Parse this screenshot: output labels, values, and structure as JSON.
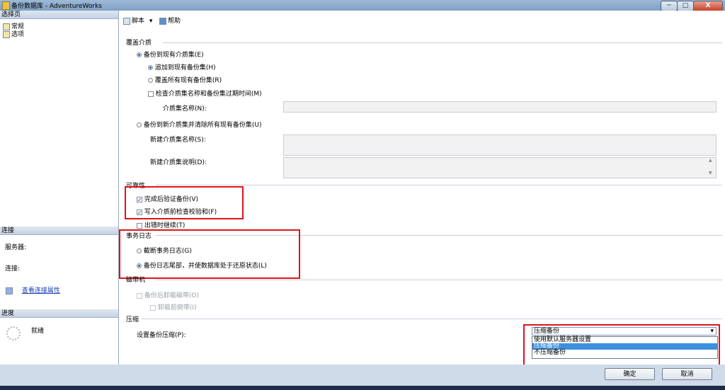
{
  "window": {
    "title": "备份数据库 - AdventureWorks",
    "min_label": "─",
    "max_label": "□",
    "close_label": "X"
  },
  "left": {
    "select_page_header": "选择页",
    "pages": [
      "常规",
      "选项"
    ],
    "connection_header": "连接",
    "server_label": "服务器:",
    "connection_label": "连接:",
    "view_connection_props": "查看连接属性",
    "progress_header": "进度",
    "progress_status": "就绪"
  },
  "toolbar": {
    "script_label": "脚本",
    "help_label": "帮助"
  },
  "overwrite_media": {
    "header": "覆盖介质",
    "backup_existing": "备份到现有介质集(E)",
    "append": "追加到现有备份集(H)",
    "overwrite_all": "覆盖所有现有备份集(R)",
    "check_name_expiry": "检查介质集名称和备份集过期时间(M)",
    "media_set_name": "介质集名称(N):",
    "backup_new": "备份到新介质集并清除所有现有备份集(U)",
    "new_media_set_name": "新建介质集名称(S):",
    "new_media_set_desc": "新建介质集说明(D):"
  },
  "reliability": {
    "header": "可靠性",
    "verify": "完成后验证备份(V)",
    "checksum": "写入介质前检查校验和(F)",
    "continue_on_error": "出错时继续(T)"
  },
  "transaction_log": {
    "header": "事务日志",
    "truncate": "截断事务日志(G)",
    "backup_tail": "备份日志尾部，并使数据库处于还原状态(L)"
  },
  "tape": {
    "header": "磁带机",
    "unload": "备份后卸载磁带(O)",
    "rewind": "卸载前倒带(I)"
  },
  "compression": {
    "header": "压缩",
    "label": "设置备份压缩(P):",
    "selected": "压缩备份",
    "options": [
      "使用默认服务器设置",
      "压缩备份",
      "不压缩备份"
    ],
    "highlighted_index": 1
  },
  "buttons": {
    "ok": "确定",
    "cancel": "取消"
  },
  "colors": {
    "highlight_red": "#e0141b",
    "selection_blue": "#3d8fe0"
  }
}
